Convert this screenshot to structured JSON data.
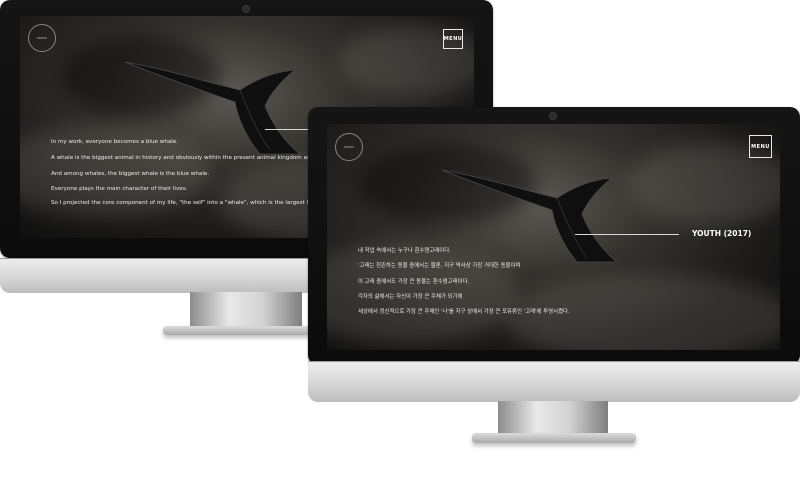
{
  "back_monitor": {
    "menu_label": "MENU",
    "paragraphs": [
      "In my work, everyone becomes a blue whale.",
      "A whale is the biggest animal in history and obviously within the present animal kingdom as well.",
      "And among whales, the biggest whale is the blue whale.",
      "Everyone plays the main character of their lives.",
      "So I projected the core component of my life, \"the self\" into a \"whale\", which is the largest living mammal"
    ]
  },
  "front_monitor": {
    "menu_label": "MENU",
    "section_title": "YOUTH (2017)",
    "paragraphs": [
      "내 작업 속에서는 누구나 흰수염고래이다.",
      "'고래는 현존하는 동물 중에서는 물론, 지구 역사상 가장 거대한 동물이며",
      "이 고래 중에서도 가장 큰 동물는 흰수염고래이다.",
      "각자의 삶에서는 자신이 가장 큰 주체가 되기에",
      "세상에서 정신적으로 가장 큰 주체인 '나'를 지구 상에서 가장 큰 포유류인 '고래'에 투영시켰다."
    ]
  }
}
